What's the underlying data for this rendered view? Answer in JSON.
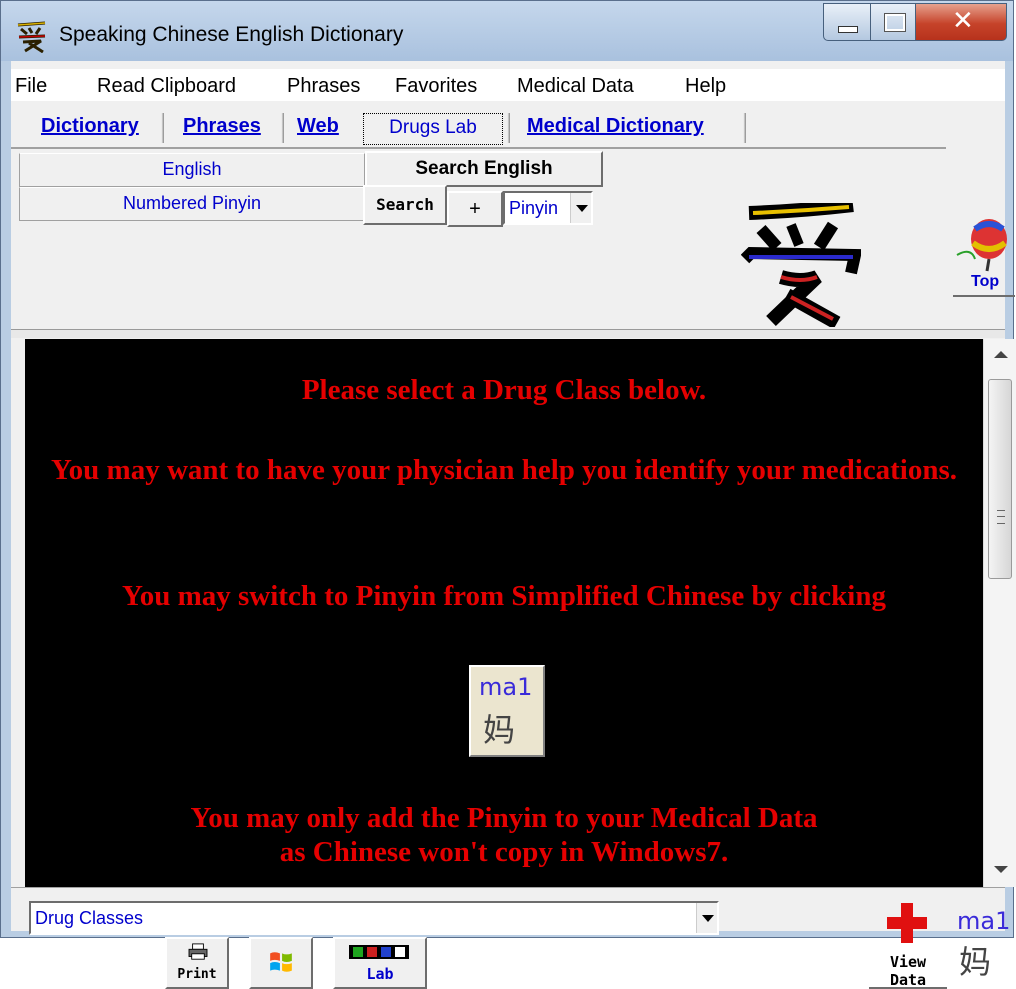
{
  "window": {
    "title": "Speaking Chinese English Dictionary",
    "title_icon": "ai-character-icon",
    "controls": [
      "minimize",
      "maximize",
      "close"
    ]
  },
  "menubar": {
    "items": [
      "File",
      "Read Clipboard",
      "Phrases",
      "Favorites",
      "Medical Data",
      "Help"
    ]
  },
  "tabs": {
    "items": [
      "Dictionary",
      "Phrases",
      "Web",
      "Drugs Lab",
      "Medical Dictionary"
    ],
    "active": "Drugs Lab"
  },
  "search": {
    "english_field": "English",
    "pinyin_field": "Numbered Pinyin",
    "search_english_label": "Search English",
    "search_label": "Search",
    "plus_label": "+",
    "mode_select": "Pinyin"
  },
  "top_button": {
    "label": "Top"
  },
  "viewer": {
    "line1": "Please select a Drug Class below.",
    "line2": "You may want to have your physician help you identify your medications.",
    "line3": "You may switch to Pinyin from Simplified Chinese by clicking",
    "ma_pinyin": "ma1",
    "ma_char": "妈",
    "line4": "You may only add the Pinyin  to your Medical Data",
    "line5": "as Chinese won't copy in Windows7."
  },
  "bottom": {
    "combo_value": "Drug Classes",
    "print_label": "Print",
    "lab_label": "Lab",
    "view_data_line1": "View",
    "view_data_line2": "Data",
    "ma_pinyin": "ma1",
    "ma_char": "妈"
  },
  "colors": {
    "viewer_bg": "#000000",
    "message_red": "#e50000",
    "link_blue": "#0000cc",
    "window_frame": "#b9cde3"
  }
}
